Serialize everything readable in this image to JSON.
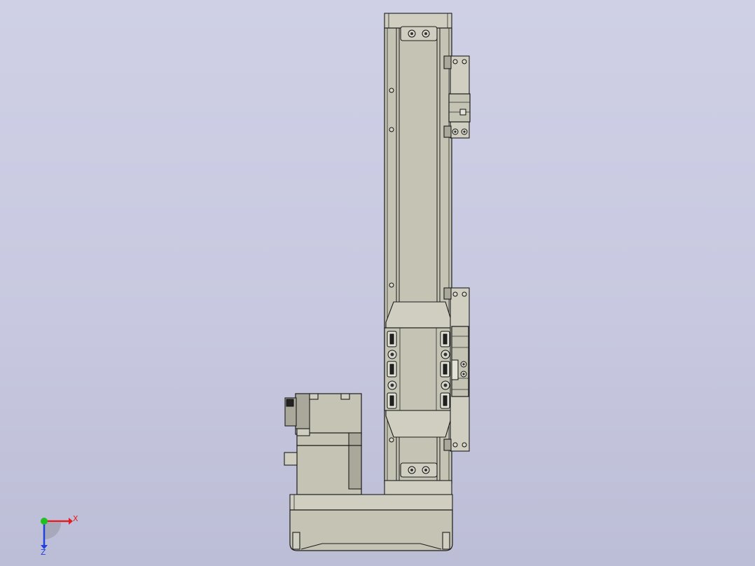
{
  "triad": {
    "x_label": "X",
    "z_label": "Z",
    "x_color": "#e02020",
    "y_color": "#20c020",
    "z_color": "#2040e0"
  },
  "colors": {
    "background_top": "#cfd0e6",
    "background_bottom": "#bcbdd6",
    "part_fill": "#c4c3b4",
    "edge": "#1c1c1c"
  }
}
